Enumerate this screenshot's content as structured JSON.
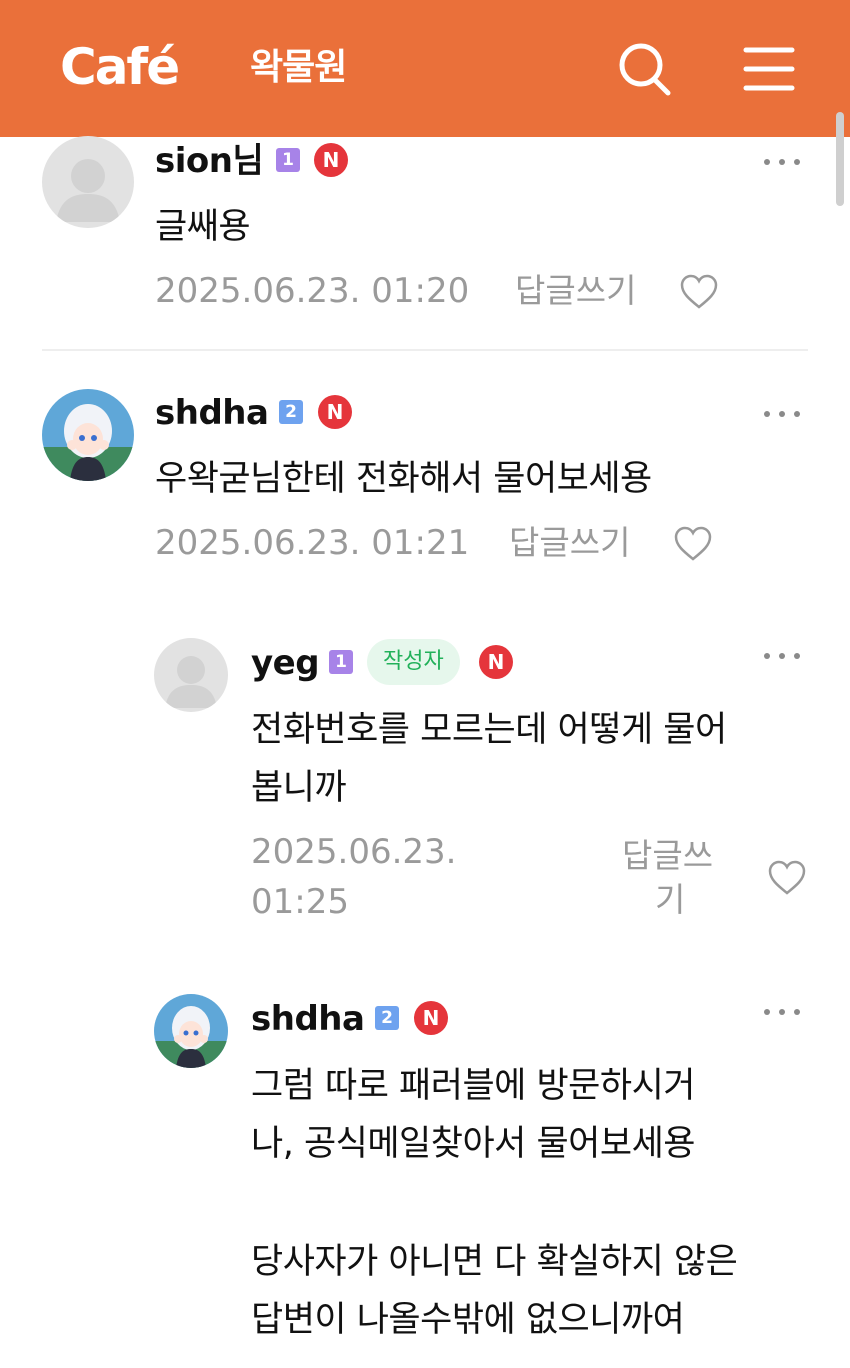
{
  "colors": {
    "brand": "#ea703a",
    "author_tag_bg": "#e6f7ec",
    "author_tag_text": "#22b15a",
    "badge_red": "#e5353b"
  },
  "header": {
    "logo": "Café",
    "cafe_name": "왁물원",
    "search_icon": "search-icon",
    "menu_icon": "hamburger-menu-icon"
  },
  "comments": [
    {
      "username": "sion님",
      "level": "1",
      "badge": "N",
      "text": "글쌔용",
      "time": "2025.06.23. 01:20",
      "reply": "답글쓰기",
      "avatar": "default-avatar"
    },
    {
      "username": "shdha",
      "level": "2",
      "badge": "N",
      "text": "우왁굳님한테 전화해서 물어보세용",
      "time": "2025.06.23. 01:21",
      "reply": "답글쓰기",
      "avatar": "anime-character-avatar"
    },
    {
      "username": "yeg",
      "level": "1",
      "author_tag": "작성자",
      "badge": "N",
      "text_lines": [
        "전화번호를 모르는데 어떻게 물어",
        "봅니까"
      ],
      "time_lines": [
        "2025.06.23.",
        "01:25"
      ],
      "reply_lines": [
        "답글쓰",
        "기"
      ],
      "avatar": "default-avatar"
    },
    {
      "username": "shdha",
      "level": "2",
      "badge": "N",
      "text_lines": [
        "그럼 따로 패러블에 방문하시거",
        "나, 공식메일찾아서 물어보세용",
        "",
        "당사자가 아니면 다 확실하지 않은",
        "답변이 나올수밖에 없으니까여"
      ],
      "avatar": "anime-character-avatar"
    }
  ]
}
